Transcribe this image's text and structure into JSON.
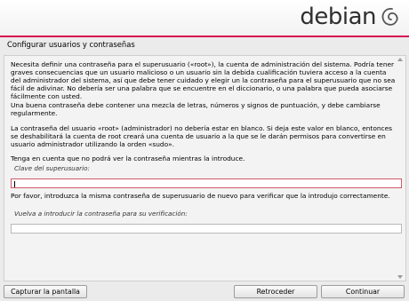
{
  "header": {
    "brand": "debian",
    "logo_icon": "debian-swirl-icon",
    "accent_color": "#d70751"
  },
  "page": {
    "title": "Configurar usuarios y contraseñas"
  },
  "body": {
    "paragraphs": [
      "Necesita definir una contraseña para el superusuario («root»), la cuenta de administración del sistema. Podría tener graves consecuencias que un usuario malicioso o un usuario sin la debida cualificación tuviera acceso a la cuenta del administrador del sistema, así que debe tener cuidado y elegir un la contraseña para el superusuario que no sea fácil de adivinar. No debería ser una palabra que se encuentre en el diccionario, o una palabra que pueda asociarse fácilmente con usted.",
      "Una buena contraseña debe contener una mezcla de letras, números y signos de puntuación, y debe cambiarse regularmente.",
      "La contraseña del usuario «root» (administrador) no debería estar en blanco. Si deja este valor en blanco, entonces se deshabilitará la cuenta de root creará una cuenta de usuario a la que se le darán permisos para convertirse en usuario administrador utilizando la orden «sudo».",
      "Tenga en cuenta que no podrá ver la contraseña mientras la introduce."
    ],
    "password_label": "Clave del superusuario:",
    "password_value": "",
    "verify_instruction": "Por favor, introduzca la misma contraseña de superusuario de nuevo para verificar que la introdujo correctamente.",
    "verify_label": "Vuelva a introducir la contraseña para su verificación:",
    "verify_value": ""
  },
  "buttons": {
    "screenshot": "Capturar la pantalla",
    "back": "Retroceder",
    "continue": "Continuar"
  }
}
